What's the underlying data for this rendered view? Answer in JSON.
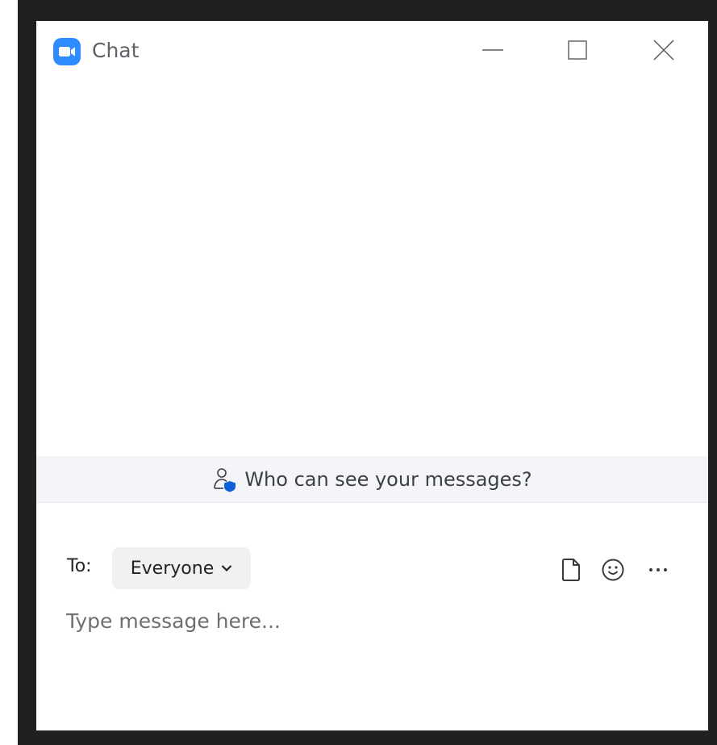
{
  "window": {
    "title": "Chat",
    "controls": {
      "minimize": "minimize",
      "maximize": "maximize",
      "close": "close"
    }
  },
  "visibility_notice": {
    "label": "Who can see your messages?"
  },
  "compose": {
    "to_label": "To:",
    "recipient": "Everyone",
    "input_placeholder": "Type message here..."
  },
  "icons": {
    "app_logo": "zoom-camera-icon",
    "visibility": "person-shield-icon",
    "file": "file-icon",
    "emoji": "emoji-icon",
    "more": "more-icon"
  },
  "colors": {
    "brand_blue": "#2d8cff",
    "frame": "#202020",
    "banner_bg": "#f4f5f9",
    "recipient_bg": "#f1f1f4"
  }
}
